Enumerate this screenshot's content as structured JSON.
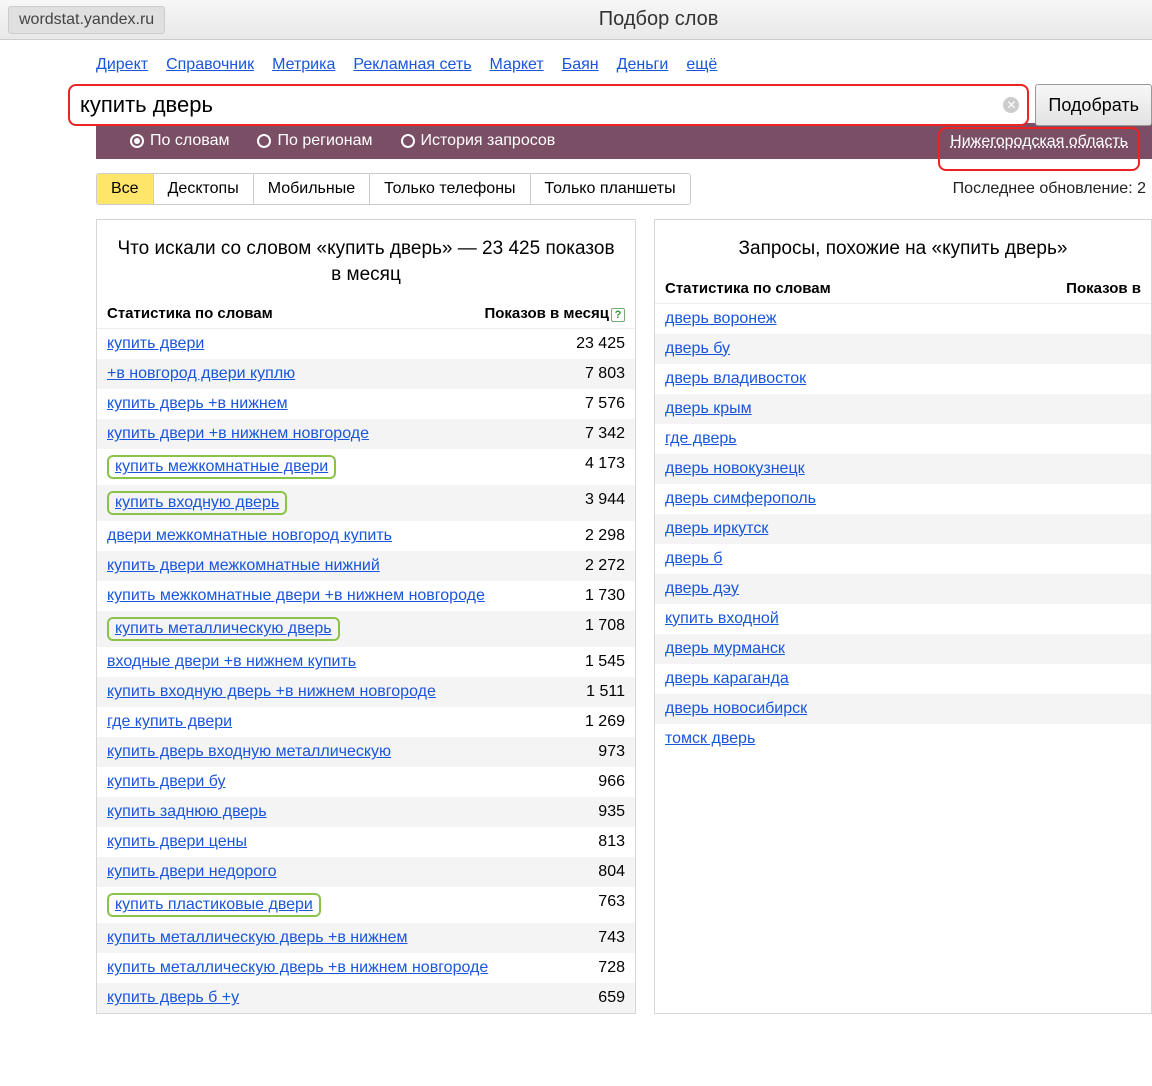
{
  "browser": {
    "url": "wordstat.yandex.ru",
    "page_title": "Подбор слов"
  },
  "topnav": [
    "Директ",
    "Справочник",
    "Метрика",
    "Рекламная сеть",
    "Маркет",
    "Баян",
    "Деньги",
    "ещё"
  ],
  "search": {
    "value": "купить дверь",
    "submit": "Подобрать"
  },
  "radios": {
    "words": "По словам",
    "regions": "По регионам",
    "history": "История запросов"
  },
  "region": "Нижегородская область",
  "tabs": [
    "Все",
    "Десктопы",
    "Мобильные",
    "Только телефоны",
    "Только планшеты"
  ],
  "update_text": "Последнее обновление: 2",
  "left": {
    "title": "Что искали со словом «купить дверь» — 23 425 показов в месяц",
    "th_l": "Статистика по словам",
    "th_r": "Показов в месяц",
    "rows": [
      {
        "q": "купить двери",
        "n": "23 425",
        "hl": false
      },
      {
        "q": "+в новгород двери куплю",
        "n": "7 803",
        "hl": false
      },
      {
        "q": "купить дверь +в нижнем",
        "n": "7 576",
        "hl": false
      },
      {
        "q": "купить двери +в нижнем новгороде",
        "n": "7 342",
        "hl": false
      },
      {
        "q": "купить межкомнатные двери",
        "n": "4 173",
        "hl": true
      },
      {
        "q": "купить входную дверь",
        "n": "3 944",
        "hl": true
      },
      {
        "q": "двери межкомнатные новгород купить",
        "n": "2 298",
        "hl": false
      },
      {
        "q": "купить двери межкомнатные нижний",
        "n": "2 272",
        "hl": false
      },
      {
        "q": "купить межкомнатные двери +в нижнем новгороде",
        "n": "1 730",
        "hl": false
      },
      {
        "q": "купить металлическую дверь",
        "n": "1 708",
        "hl": true
      },
      {
        "q": "входные двери +в нижнем купить",
        "n": "1 545",
        "hl": false
      },
      {
        "q": "купить входную дверь +в нижнем новгороде",
        "n": "1 511",
        "hl": false
      },
      {
        "q": "где купить двери",
        "n": "1 269",
        "hl": false
      },
      {
        "q": "купить дверь входную металлическую",
        "n": "973",
        "hl": false
      },
      {
        "q": "купить двери бу",
        "n": "966",
        "hl": false
      },
      {
        "q": "купить заднюю дверь",
        "n": "935",
        "hl": false
      },
      {
        "q": "купить двери цены",
        "n": "813",
        "hl": false
      },
      {
        "q": "купить двери недорого",
        "n": "804",
        "hl": false
      },
      {
        "q": "купить пластиковые двери",
        "n": "763",
        "hl": true
      },
      {
        "q": "купить металлическую дверь +в нижнем",
        "n": "743",
        "hl": false
      },
      {
        "q": "купить металлическую дверь +в нижнем новгороде",
        "n": "728",
        "hl": false
      },
      {
        "q": "купить дверь б +у",
        "n": "659",
        "hl": false
      }
    ]
  },
  "right": {
    "title": "Запросы, похожие на «купить дверь»",
    "th_l": "Статистика по словам",
    "th_r": "Показов в",
    "rows": [
      {
        "q": "дверь воронеж"
      },
      {
        "q": "дверь бу"
      },
      {
        "q": "дверь владивосток"
      },
      {
        "q": "дверь крым"
      },
      {
        "q": "где дверь"
      },
      {
        "q": "дверь новокузнецк"
      },
      {
        "q": "дверь симферополь"
      },
      {
        "q": "дверь иркутск"
      },
      {
        "q": "дверь б"
      },
      {
        "q": "дверь дэу"
      },
      {
        "q": "купить входной"
      },
      {
        "q": "дверь мурманск"
      },
      {
        "q": "дверь караганда"
      },
      {
        "q": "дверь новосибирск"
      },
      {
        "q": "томск дверь"
      }
    ]
  }
}
